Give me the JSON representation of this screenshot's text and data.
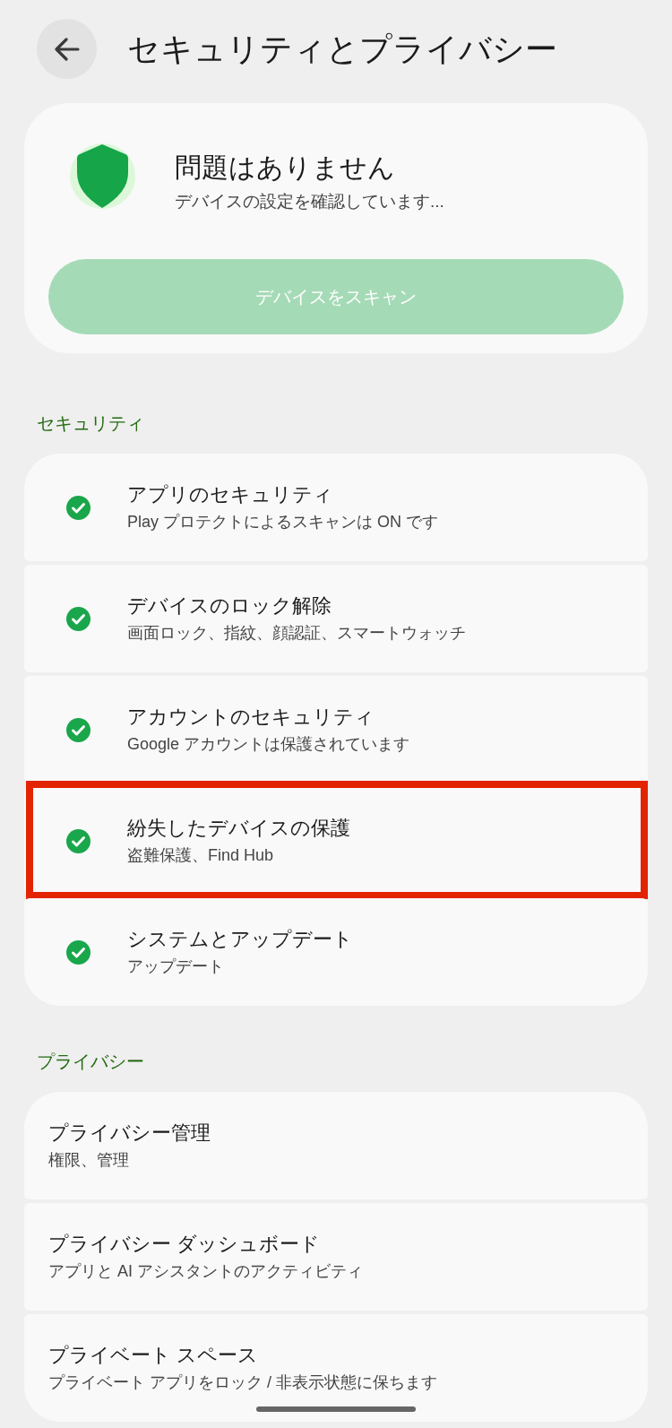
{
  "header": {
    "title": "セキュリティとプライバシー"
  },
  "status_card": {
    "title": "問題はありません",
    "subtitle": "デバイスの設定を確認しています...",
    "scan_button": {
      "label": "デバイスをスキャン",
      "disabled": true
    }
  },
  "sections": [
    {
      "heading": "セキュリティ",
      "items": [
        {
          "title": "アプリのセキュリティ",
          "subtitle": "Play プロテクトによるスキャンは ON です",
          "ok": true,
          "highlighted": false
        },
        {
          "title": "デバイスのロック解除",
          "subtitle": "画面ロック、指紋、顔認証、スマートウォッチ",
          "ok": true,
          "highlighted": false
        },
        {
          "title": "アカウントのセキュリティ",
          "subtitle": "Google アカウントは保護されています",
          "ok": true,
          "highlighted": false
        },
        {
          "title": "紛失したデバイスの保護",
          "subtitle": "盗難保護、Find Hub",
          "ok": true,
          "highlighted": true
        },
        {
          "title": "システムとアップデート",
          "subtitle": "アップデート",
          "ok": true,
          "highlighted": false
        }
      ]
    },
    {
      "heading": "プライバシー",
      "items": [
        {
          "title": "プライバシー管理",
          "subtitle": "権限、管理",
          "highlighted": false
        },
        {
          "title": "プライバシー ダッシュボード",
          "subtitle": "アプリと AI アシスタントのアクティビティ",
          "highlighted": false
        },
        {
          "title": "プライベート スペース",
          "subtitle": "プライベート アプリをロック / 非表示状態に保ちます",
          "highlighted": false
        }
      ]
    }
  ]
}
